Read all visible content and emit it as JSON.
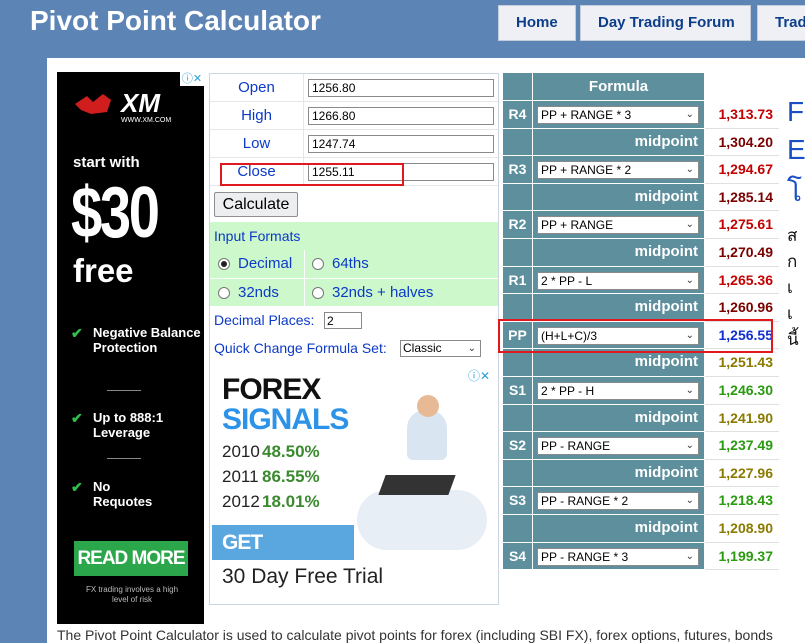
{
  "header": {
    "title": "Pivot Point Calculator",
    "nav": [
      "Home",
      "Day Trading Forum",
      "Trad"
    ]
  },
  "ad_left": {
    "adchoices_icon": "adchoices-icon",
    "brand": "XM",
    "brand_url": "WWW.XM.COM",
    "start": "start with",
    "amount": "$30",
    "free": "free",
    "features": [
      "Negative Balance Protection",
      "Up to 888:1 Leverage",
      "No Requotes"
    ],
    "cta": "READ MORE",
    "risk": "FX trading involves a high level of risk"
  },
  "calculator": {
    "inputs": [
      {
        "label": "Open",
        "value": "1256.80"
      },
      {
        "label": "High",
        "value": "1266.80"
      },
      {
        "label": "Low",
        "value": "1247.74"
      },
      {
        "label": "Close",
        "value": "1255.11"
      }
    ],
    "calculate_label": "Calculate",
    "input_formats_title": "Input Formats",
    "formats": [
      {
        "label": "Decimal",
        "selected": true
      },
      {
        "label": "64ths",
        "selected": false
      },
      {
        "label": "32nds",
        "selected": false
      },
      {
        "label": "32nds + halves",
        "selected": false
      }
    ],
    "decimal_places_label": "Decimal Places:",
    "decimal_places_value": "2",
    "quick_change_label": "Quick Change Formula Set:",
    "quick_change_value": "Classic"
  },
  "ad_forex": {
    "adchoices_icon": "adchoices-icon",
    "title1": "FOREX",
    "title2": "SIGNALS",
    "years": [
      {
        "year": "2010",
        "pct": "48.50%"
      },
      {
        "year": "2011",
        "pct": "86.55%"
      },
      {
        "year": "2012",
        "pct": "18.01%"
      }
    ],
    "cta": "GET STARTED",
    "trial": "30 Day Free Trial"
  },
  "formula_table": {
    "header": "Formula",
    "midpoint_label": "midpoint",
    "levels": [
      {
        "name": "R4",
        "formula": "PP + RANGE * 3",
        "value": "1,313.73",
        "color": "#c40000"
      },
      {
        "mid": "1,304.20",
        "color": "#7a0000"
      },
      {
        "name": "R3",
        "formula": "PP + RANGE * 2",
        "value": "1,294.67",
        "color": "#c40000"
      },
      {
        "mid": "1,285.14",
        "color": "#7a0000"
      },
      {
        "name": "R2",
        "formula": "PP + RANGE",
        "value": "1,275.61",
        "color": "#c40000"
      },
      {
        "mid": "1,270.49",
        "color": "#7a0000"
      },
      {
        "name": "R1",
        "formula": "2 * PP - L",
        "value": "1,265.36",
        "color": "#c40000"
      },
      {
        "mid": "1,260.96",
        "color": "#7a0000"
      },
      {
        "name": "PP",
        "formula": "(H+L+C)/3",
        "value": "1,256.55",
        "color": "#1030d0"
      },
      {
        "mid": "1,251.43",
        "color": "#8a7a00"
      },
      {
        "name": "S1",
        "formula": "2 * PP - H",
        "value": "1,246.30",
        "color": "#2a9a10"
      },
      {
        "mid": "1,241.90",
        "color": "#8a7a00"
      },
      {
        "name": "S2",
        "formula": "PP - RANGE",
        "value": "1,237.49",
        "color": "#2a9a10"
      },
      {
        "mid": "1,227.96",
        "color": "#8a7a00"
      },
      {
        "name": "S3",
        "formula": "PP - RANGE * 2",
        "value": "1,218.43",
        "color": "#2a9a10"
      },
      {
        "mid": "1,208.90",
        "color": "#8a7a00"
      },
      {
        "name": "S4",
        "formula": "PP - RANGE * 3",
        "value": "1,199.37",
        "color": "#2a9a10"
      }
    ]
  },
  "right_column": {
    "big1": "F",
    "big2": "E",
    "big3": "โ",
    "lines": [
      "ส",
      "ก",
      "เ",
      "เ",
      "นี้"
    ]
  },
  "footer": "The Pivot Point Calculator is used to calculate pivot points for forex (including SBI FX), forex options, futures, bonds"
}
